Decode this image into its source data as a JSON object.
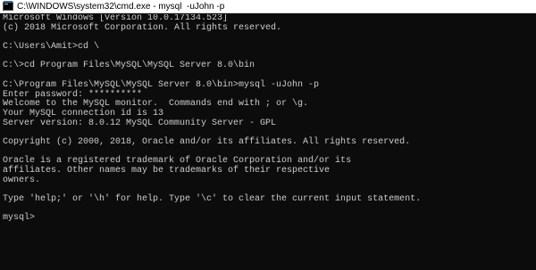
{
  "window": {
    "title": "C:\\WINDOWS\\system32\\cmd.exe - mysql  -uJohn -p",
    "icon": "cmd-icon"
  },
  "colors": {
    "console_background": "#0c0c0c",
    "console_text": "#cccccc",
    "titlebar_background": "#ffffff"
  },
  "console": {
    "lines": [
      "Microsoft Windows [Version 10.0.17134.523]",
      "(c) 2018 Microsoft Corporation. All rights reserved.",
      "",
      "C:\\Users\\Amit>cd \\",
      "",
      "C:\\>cd Program Files\\MySQL\\MySQL Server 8.0\\bin",
      "",
      "C:\\Program Files\\MySQL\\MySQL Server 8.0\\bin>mysql -uJohn -p",
      "Enter password: **********",
      "Welcome to the MySQL monitor.  Commands end with ; or \\g.",
      "Your MySQL connection id is 13",
      "Server version: 8.0.12 MySQL Community Server - GPL",
      "",
      "Copyright (c) 2000, 2018, Oracle and/or its affiliates. All rights reserved.",
      "",
      "Oracle is a registered trademark of Oracle Corporation and/or its",
      "affiliates. Other names may be trademarks of their respective",
      "owners.",
      "",
      "Type 'help;' or '\\h' for help. Type '\\c' to clear the current input statement.",
      "",
      "mysql>"
    ]
  }
}
